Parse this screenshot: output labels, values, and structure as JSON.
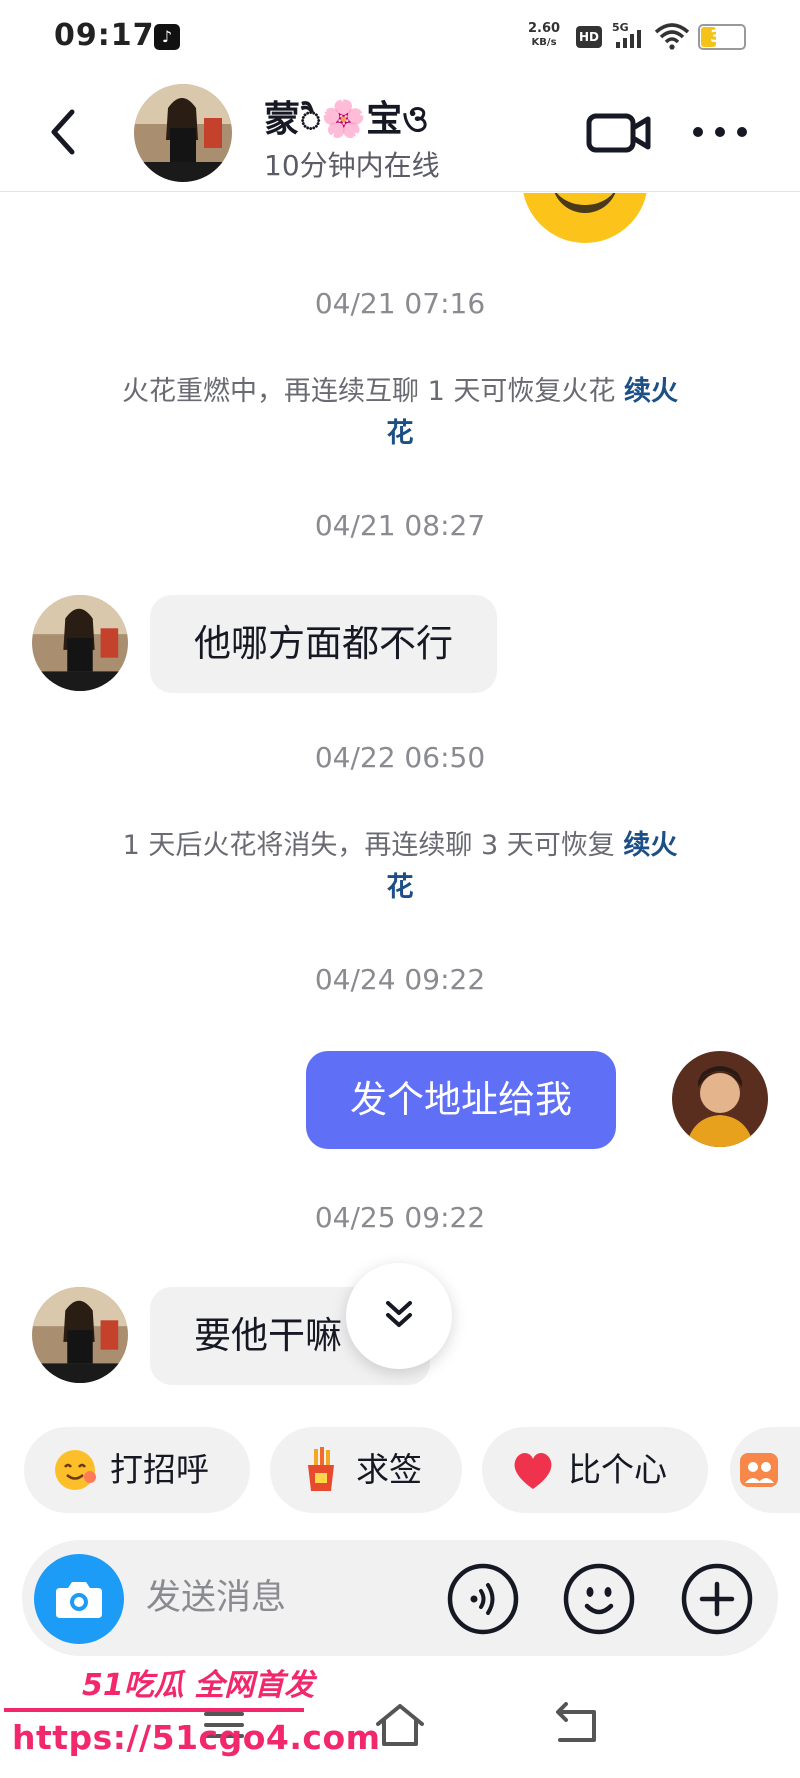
{
  "status_bar": {
    "time": "09:17",
    "net_speed_value": "2.60",
    "net_speed_unit": "KB/s",
    "hd_label": "HD",
    "network": "5G",
    "battery_level": "36",
    "battery_fraction": 0.36,
    "battery_color": "#f5c21a"
  },
  "header": {
    "contact_name": "蒙ै🌸宝ও",
    "online_status": "10分钟内在线",
    "icons": [
      "chevron-left-icon",
      "video-camera-icon",
      "more-icon"
    ]
  },
  "chat": {
    "timestamps": [
      "04/21 07:16",
      "04/21 08:27",
      "04/22 06:50",
      "04/24 09:22",
      "04/25 09:22"
    ],
    "system_messages": [
      {
        "text": "火花重燃中，再连续互聊 1 天可恢复火花",
        "link": "续火花"
      },
      {
        "text": "1 天后火花将消失，再连续聊 3 天可恢复",
        "link": "续火花"
      }
    ],
    "messages": [
      {
        "direction": "incoming",
        "text": "他哪方面都不行"
      },
      {
        "direction": "outgoing",
        "text": "发个地址给我"
      },
      {
        "direction": "incoming",
        "text": "要他干嘛"
      }
    ],
    "bubble_out_color": "#5f6ff6",
    "bubble_in_color": "#f1f1f2"
  },
  "quick_replies": [
    {
      "label": "打招呼",
      "icon": "smiling-face-icon"
    },
    {
      "label": "求签",
      "icon": "fortune-sticks-icon"
    },
    {
      "label": "比个心",
      "icon": "heart-icon"
    },
    {
      "label": "",
      "icon": "group-photo-icon"
    }
  ],
  "input": {
    "placeholder": "发送消息",
    "icons": [
      "camera-icon",
      "voice-icon",
      "emoji-icon",
      "plus-icon"
    ],
    "camera_color": "#1c9cf6"
  },
  "watermark": {
    "title": "51吃瓜 全网首发",
    "url": "https://51cgo4.com",
    "color": "#f2276c"
  }
}
